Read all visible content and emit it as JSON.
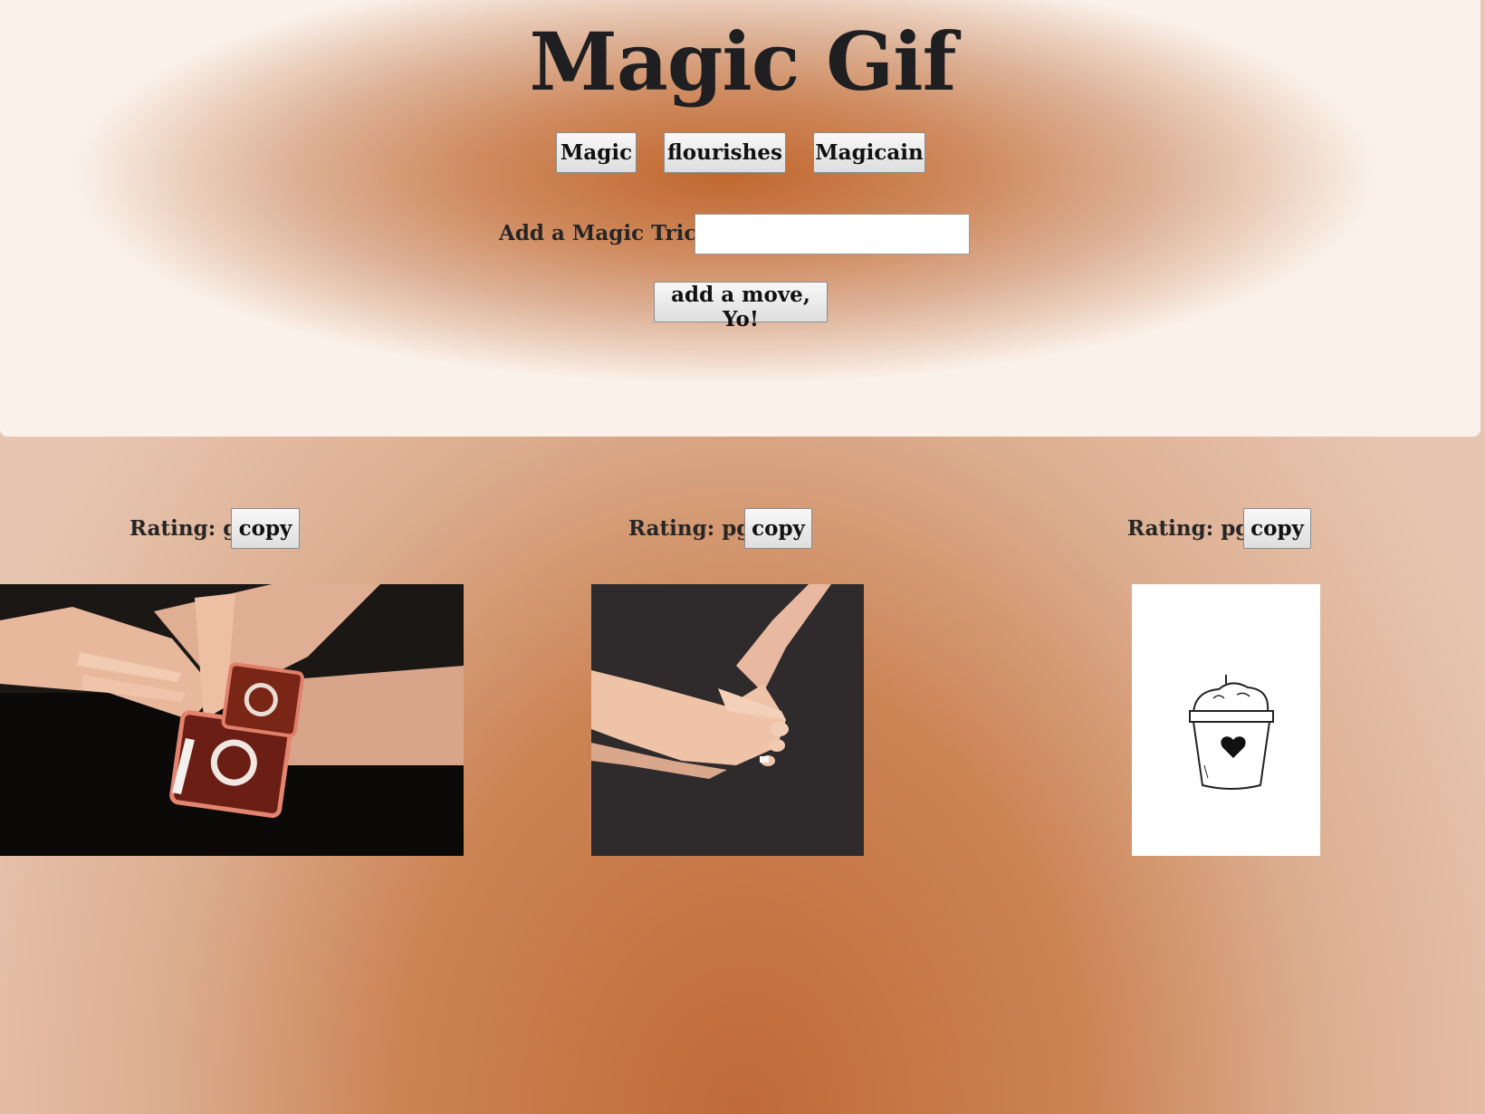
{
  "app": {
    "title": "Magic Gif"
  },
  "topics": [
    {
      "label": "Magic"
    },
    {
      "label": "flourishes"
    },
    {
      "label": "Magicain"
    }
  ],
  "form": {
    "label": "Add a Magic Trick",
    "input_value": "",
    "submit_label": "add a move, Yo!"
  },
  "results": [
    {
      "rating": "Rating: g",
      "copy_label": "copy",
      "image": "card-trick-hands-gif"
    },
    {
      "rating": "Rating: pg",
      "copy_label": "copy",
      "image": "hand-foot-illusion-gif"
    },
    {
      "rating": "Rating: pg",
      "copy_label": "copy",
      "image": "flower-pot-drawing-gif"
    }
  ]
}
